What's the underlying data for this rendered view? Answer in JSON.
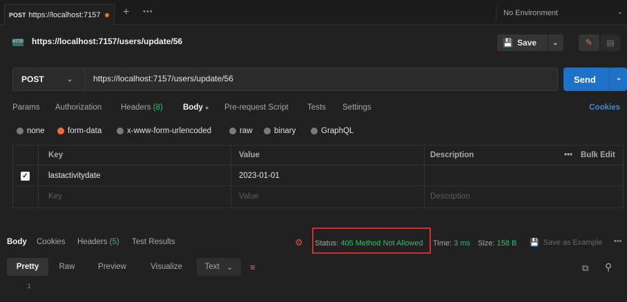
{
  "tab": {
    "method": "POST",
    "title": "https://localhost:7157",
    "plus": "+",
    "more": "•••"
  },
  "environment": {
    "label": "No Environment"
  },
  "request": {
    "title": "https://localhost:7157/users/update/56",
    "http_badge": "HTTP",
    "save_label": "Save",
    "method": "POST",
    "url": "https://localhost:7157/users/update/56",
    "send_label": "Send"
  },
  "request_tabs": {
    "params": "Params",
    "authorization": "Authorization",
    "headers": "Headers",
    "headers_count": "(8)",
    "body": "Body",
    "pre_request": "Pre-request Script",
    "tests": "Tests",
    "settings": "Settings",
    "cookies": "Cookies"
  },
  "body_types": {
    "none": "none",
    "form_data": "form-data",
    "urlencoded": "x-www-form-urlencoded",
    "raw": "raw",
    "binary": "binary",
    "graphql": "GraphQL",
    "selected": "form-data"
  },
  "params_table": {
    "headers": {
      "key": "Key",
      "value": "Value",
      "description": "Description",
      "bulk_edit": "Bulk Edit",
      "more": "•••"
    },
    "rows": [
      {
        "checked": true,
        "key": "lastactivitydate",
        "value": "2023-01-01",
        "description": ""
      }
    ],
    "placeholder": {
      "key": "Key",
      "value": "Value",
      "description": "Description"
    }
  },
  "response": {
    "tabs": {
      "body": "Body",
      "cookies": "Cookies",
      "headers": "Headers",
      "headers_count": "(5)",
      "test_results": "Test Results"
    },
    "status_label": "Status:",
    "status_value": "405 Method Not Allowed",
    "time_label": "Time:",
    "time_value": "3 ms",
    "size_label": "Size:",
    "size_value": "158 B",
    "save_example": "Save as Example",
    "more": "•••",
    "views": {
      "pretty": "Pretty",
      "raw": "Raw",
      "preview": "Preview",
      "visualize": "Visualize"
    },
    "format": "Text",
    "line_number": "1"
  },
  "colors": {
    "accent": "#f26b3a",
    "send": "#1e73c8",
    "status_ok": "#2fbf6a",
    "highlight_box": "#d42e2e"
  }
}
